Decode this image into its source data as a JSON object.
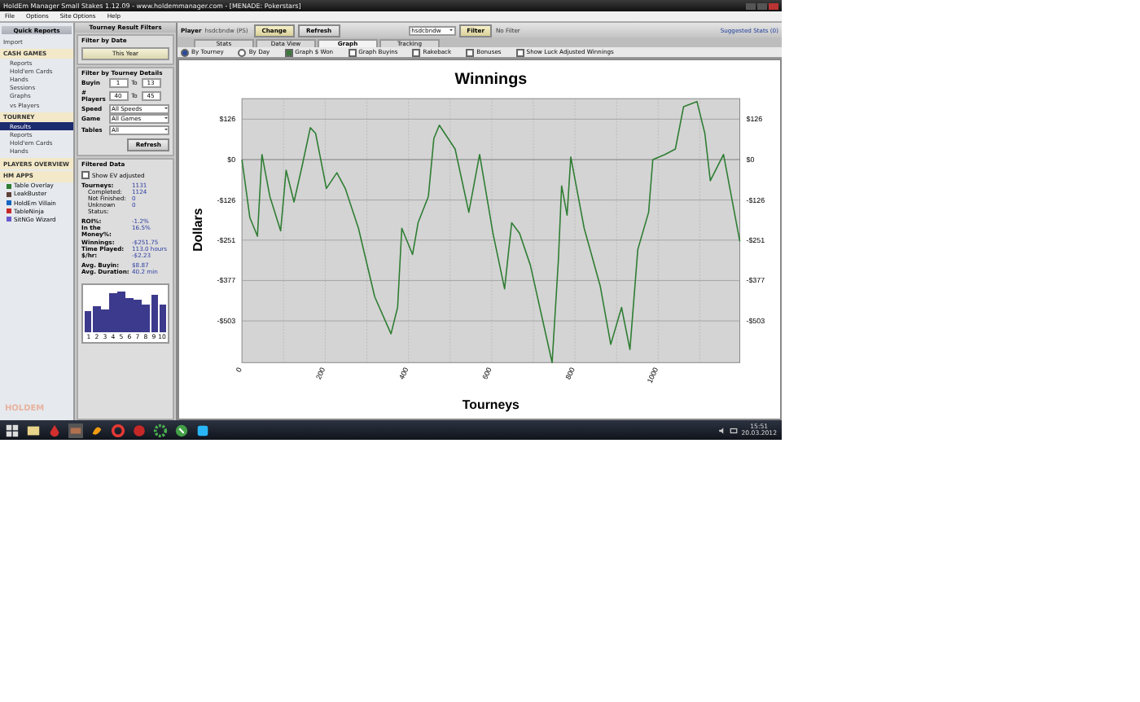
{
  "window": {
    "title": "HoldEm Manager Small Stakes 1.12.09 - www.holdemmanager.com - [MENADE: Pokerstars]"
  },
  "menu": [
    "File",
    "Options",
    "Site Options",
    "Help"
  ],
  "sidebar": {
    "header": "Quick Reports",
    "items": [
      {
        "label": "Import",
        "kind": "item",
        "selected": false
      },
      {
        "label": "CASH GAMES",
        "kind": "section",
        "selected": false,
        "children": [
          {
            "label": "Reports",
            "kind": "item",
            "selected": false
          },
          {
            "label": "Hold'em Cards",
            "kind": "item",
            "selected": false
          },
          {
            "label": "Hands",
            "kind": "item",
            "selected": false
          },
          {
            "label": "Sessions",
            "kind": "item",
            "selected": false
          },
          {
            "label": "Graphs",
            "kind": "item",
            "selected": false
          },
          {
            "label": "vs Players",
            "kind": "item",
            "selected": false
          }
        ]
      },
      {
        "label": "TOURNEY",
        "kind": "section",
        "selected": false,
        "children": [
          {
            "label": "Results",
            "kind": "item",
            "selected": true
          },
          {
            "label": "Reports",
            "kind": "item",
            "selected": false
          },
          {
            "label": "Hold'em Cards",
            "kind": "item",
            "selected": false
          },
          {
            "label": "Hands",
            "kind": "item",
            "selected": false
          }
        ]
      },
      {
        "label": "PLAYERS OVERVIEW",
        "kind": "section",
        "selected": false
      },
      {
        "label": "HM APPS",
        "kind": "section",
        "selected": false,
        "children": [
          {
            "label": "Table Overlay",
            "kind": "app",
            "selected": false,
            "color": "#2e7d32"
          },
          {
            "label": "LeakBuster",
            "kind": "app",
            "selected": false,
            "color": "#5d4037"
          },
          {
            "label": "HoldEm Villain",
            "kind": "app",
            "selected": false,
            "color": "#1565c0"
          },
          {
            "label": "TableNinja",
            "kind": "app",
            "selected": false,
            "color": "#c62828"
          },
          {
            "label": "SitNGo Wizard",
            "kind": "app",
            "selected": false,
            "color": "#6a5acd"
          }
        ]
      }
    ],
    "logo": "HOLDEM"
  },
  "filters": {
    "title": "Tourney Result Filters",
    "date_heading": "Filter by Date",
    "date_button": "This Year",
    "details_heading": "Filter by Tourney Details",
    "ranges": [
      {
        "label": "Buyin",
        "from": "1",
        "to_label": "To",
        "to": "13"
      },
      {
        "label": "# Players",
        "from": "40",
        "to_label": "To",
        "to": "45"
      }
    ],
    "selects": [
      {
        "label": "Speed",
        "value": "All Speeds"
      },
      {
        "label": "Game",
        "value": "All Games"
      },
      {
        "label": "Tables",
        "value": "All"
      }
    ],
    "refresh": "Refresh"
  },
  "filtered": {
    "title": "Filtered Data",
    "ev_checkbox": {
      "label": "Show EV adjusted",
      "checked": false
    },
    "groups": [
      [
        {
          "label": "Tourneys:",
          "value": "1131",
          "indent": false
        },
        {
          "label": "Completed:",
          "value": "1124",
          "indent": true
        },
        {
          "label": "Not Finished:",
          "value": "0",
          "indent": true
        },
        {
          "label": "Unknown Status:",
          "value": "0",
          "indent": true
        }
      ],
      [
        {
          "label": "ROI%:",
          "value": "-1.2%",
          "indent": false
        },
        {
          "label": "In the Money%:",
          "value": "16.5%",
          "indent": false
        }
      ],
      [
        {
          "label": "Winnings:",
          "value": "-$251.75",
          "indent": false
        },
        {
          "label": "Time Played:",
          "value": "113.0 hours",
          "indent": false
        },
        {
          "label": "$/hr:",
          "value": "-$2.23",
          "indent": false
        }
      ],
      [
        {
          "label": "Avg. Buyin:",
          "value": "$8.87",
          "indent": false
        },
        {
          "label": "Avg. Duration:",
          "value": "40.2 min",
          "indent": false
        }
      ]
    ],
    "histogram_labels": [
      "1",
      "2",
      "3",
      "4",
      "5",
      "6",
      "7",
      "8",
      "9",
      "10"
    ]
  },
  "toolbar": {
    "player_label": "Player",
    "player": "hsdcbndw (PS)",
    "change": "Change",
    "refresh": "Refresh",
    "filter_value": "hsdcbndw",
    "filter": "Filter",
    "filter_status": "No Filter",
    "suggested": "Suggested Stats (0)"
  },
  "tabs": [
    {
      "label": "Stats",
      "selected": false
    },
    {
      "label": "Data View",
      "selected": false
    },
    {
      "label": "Graph",
      "selected": true
    },
    {
      "label": "Tracking",
      "selected": false
    }
  ],
  "graph_options": [
    {
      "kind": "radio",
      "label": "By Tourney",
      "checked": true
    },
    {
      "kind": "radio",
      "label": "By Day",
      "checked": false
    },
    {
      "kind": "check",
      "label": "Graph $ Won",
      "checked": true
    },
    {
      "kind": "check",
      "label": "Graph Buyins",
      "checked": false
    },
    {
      "kind": "check",
      "label": "Rakeback",
      "checked": false
    },
    {
      "kind": "check",
      "label": "Bonuses",
      "checked": false
    },
    {
      "kind": "check",
      "label": "Show Luck Adjusted Winnings",
      "checked": false
    }
  ],
  "chart": {
    "mirror_y_axis": true,
    "chart_data": {
      "type": "line",
      "title": "Winnings",
      "xlabel": "Tourneys",
      "ylabel": "Dollars",
      "x": [
        0,
        19,
        37,
        48,
        67,
        93,
        106,
        125,
        145,
        164,
        177,
        203,
        228,
        248,
        280,
        319,
        358,
        374,
        384,
        410,
        423,
        448,
        461,
        474,
        512,
        545,
        571,
        603,
        631,
        648,
        667,
        693,
        745,
        760,
        768,
        781,
        790,
        822,
        861,
        886,
        912,
        932,
        951,
        977,
        987,
        1016,
        1041,
        1061,
        1093,
        1112,
        1125,
        1157,
        1196
      ],
      "series": [
        {
          "color": "#2e7d32",
          "values": [
            0,
            -181,
            -239,
            16,
            -115,
            -222,
            -33,
            -132,
            -16,
            99,
            82,
            -90,
            -41,
            -90,
            -214,
            -428,
            -543,
            -461,
            -214,
            -296,
            -197,
            -115,
            66,
            107,
            33,
            -164,
            16,
            -230,
            -403,
            -197,
            -230,
            -329,
            -633,
            -313,
            -82,
            -173,
            8,
            -214,
            -395,
            -576,
            -461,
            -592,
            -280,
            -164,
            0,
            16,
            33,
            165,
            181,
            82,
            -66,
            16,
            -255
          ]
        }
      ],
      "xlim": [
        0,
        1196
      ],
      "ylim": [
        -633,
        190
      ],
      "grid": true,
      "xticks": [
        0,
        200,
        400,
        600,
        800,
        1000
      ],
      "yticks": [
        {
          "value": 126,
          "label": "$126"
        },
        {
          "value": 0,
          "label": "$0"
        },
        {
          "value": -126,
          "label": "-$126"
        },
        {
          "value": -251,
          "label": "-$251"
        },
        {
          "value": -377,
          "label": "-$377"
        },
        {
          "value": -503,
          "label": "-$503"
        }
      ]
    }
  },
  "taskbar": {
    "time": "15:51",
    "date": "20.03.2012"
  }
}
